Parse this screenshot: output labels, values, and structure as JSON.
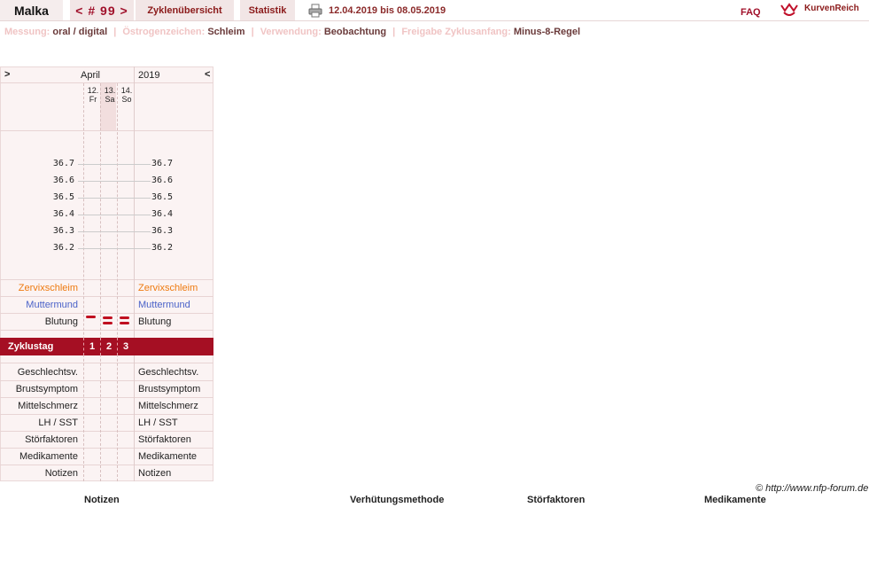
{
  "nav": {
    "name": "Malka",
    "cycle": "< # 99 >",
    "tab_overview": "Zyklenübersicht",
    "tab_stats": "Statistik",
    "date_range": "12.04.2019 bis 08.05.2019",
    "faq": "FAQ",
    "brand": "KurvenReich"
  },
  "settings": [
    {
      "label": "Messung:",
      "value": "oral / digital"
    },
    {
      "label": "Östrogenzeichen:",
      "value": "Schleim"
    },
    {
      "label": "Verwendung:",
      "value": "Beobachtung"
    },
    {
      "label": "Freigabe Zyklusanfang:",
      "value": "Minus-8-Regel"
    }
  ],
  "chart": {
    "prev": ">",
    "month": "April",
    "year": "2019",
    "next": "<",
    "days": [
      {
        "day": "12.",
        "wd": "Fr"
      },
      {
        "day": "13.",
        "wd": "Sa"
      },
      {
        "day": "14.",
        "wd": "So"
      }
    ],
    "temps": [
      "36.7",
      "36.6",
      "36.5",
      "36.4",
      "36.3",
      "36.2"
    ],
    "rows": {
      "zervix": "Zervixschleim",
      "muttermund": "Muttermund",
      "blutung": "Blutung",
      "zyklustag": "Zyklustag",
      "geschlechtsv": "Geschlechtsv.",
      "brust": "Brustsymptom",
      "mittel": "Mittelschmerz",
      "lh": "LH / SST",
      "stoer": "Störfaktoren",
      "medi": "Medikamente",
      "notizen": "Notizen"
    },
    "cycle_days": [
      "1",
      "2",
      "3"
    ],
    "bleeding_levels": [
      1,
      2,
      2
    ]
  },
  "footer": {
    "copyright": "© http://www.nfp-forum.de",
    "col1": "Notizen",
    "col2": "Verhütungsmethode",
    "col3": "Störfaktoren",
    "col4": "Medikamente"
  },
  "colors": {
    "accent": "#a50f23",
    "zervix": "#ee7a10",
    "muttermund": "#4a62c8"
  }
}
